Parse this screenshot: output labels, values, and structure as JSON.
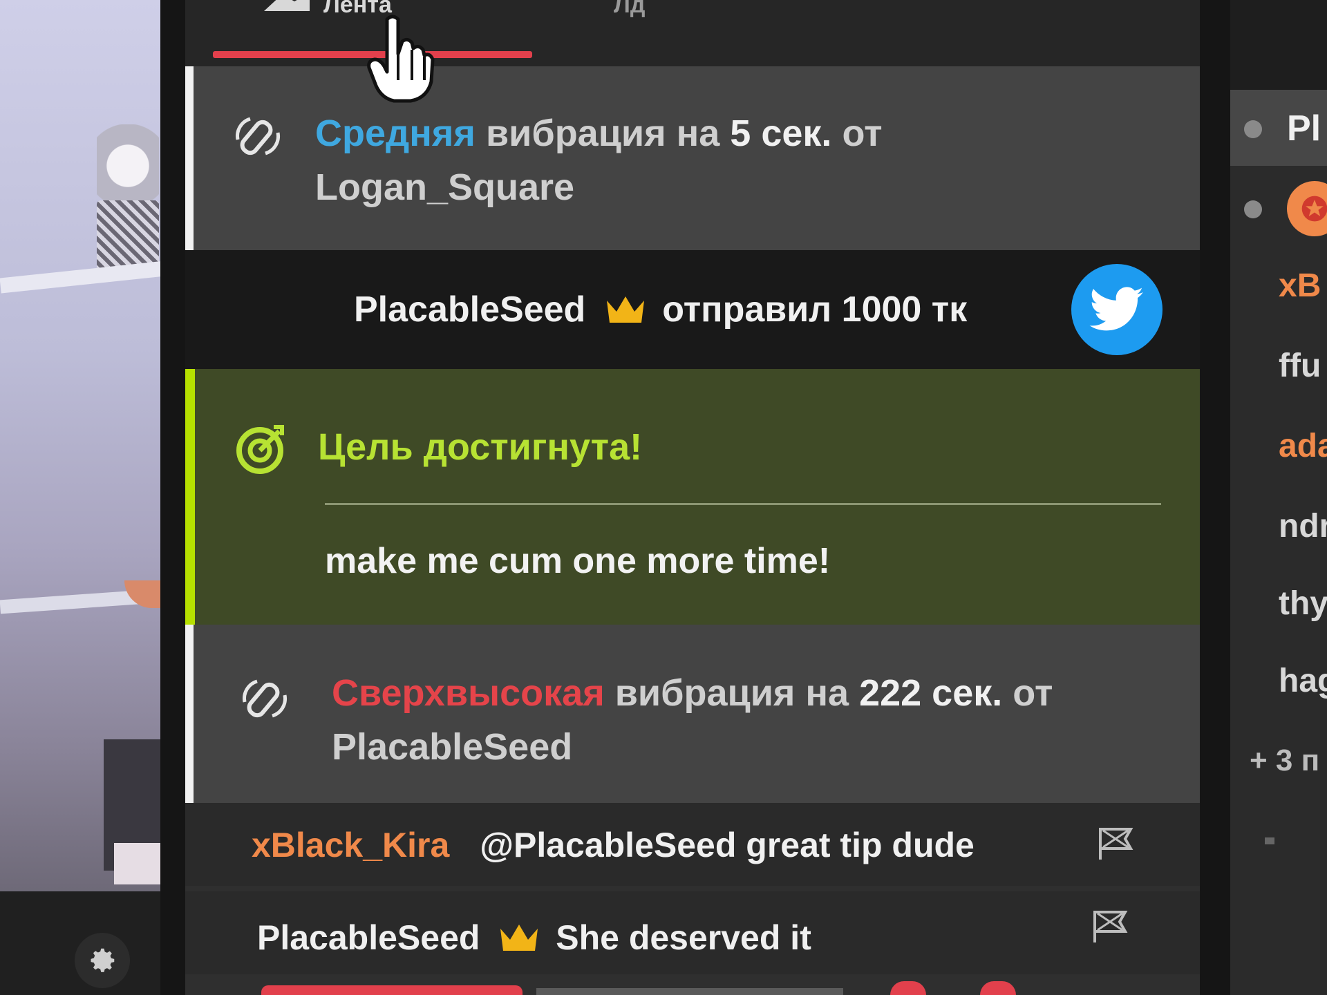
{
  "tabs": [
    {
      "label": "Лента",
      "active": true
    },
    {
      "label": "Лд",
      "active": false
    }
  ],
  "events": [
    {
      "type": "vibration",
      "level": "Средняя",
      "middle": "вибрация на",
      "duration": "5 сек.",
      "from": "от",
      "user": "Logan_Square"
    },
    {
      "type": "tip",
      "user": "PlacableSeed",
      "action": "отправил",
      "amount": "1000 тк"
    },
    {
      "type": "goal",
      "title": "Цель достигнута!",
      "message": "make me cum one more time!"
    },
    {
      "type": "vibration",
      "level": "Сверхвысокая",
      "middle": "вибрация на",
      "duration": "222 сек.",
      "from": "от",
      "user": "PlacableSeed"
    }
  ],
  "chat": [
    {
      "user": "xBlack_Kira",
      "text": "@PlacableSeed great tip dude",
      "user_color": "#f0894a"
    },
    {
      "user": "PlacableSeed",
      "text": "She deserved it",
      "user_color": "#f0f0f0",
      "crown": true
    }
  ],
  "users_panel": {
    "header": "Pl",
    "items": [
      {
        "name": "xB",
        "color": "#f0894a"
      },
      {
        "name": "ffu",
        "color": "#d8d8d8"
      },
      {
        "name": "ada",
        "color": "#f0894a"
      },
      {
        "name": "ndr",
        "color": "#d8d8d8"
      },
      {
        "name": "thy",
        "color": "#d8d8d8"
      },
      {
        "name": "hag",
        "color": "#d8d8d8"
      }
    ],
    "more": "+ 3 п"
  },
  "colors": {
    "accent_red": "#e2404c",
    "vibe_medium": "#3fa8e0",
    "vibe_ultra": "#e5444a",
    "goal_green": "#b7e233",
    "crown_gold": "#f2b417",
    "twitter_blue": "#1d9bf0"
  },
  "icons": [
    "vibration-icon",
    "crown-icon",
    "twitter-icon",
    "goal-target-icon",
    "report-flag-icon",
    "settings-gear-icon",
    "hand-cursor-icon",
    "vip-star-icon"
  ]
}
